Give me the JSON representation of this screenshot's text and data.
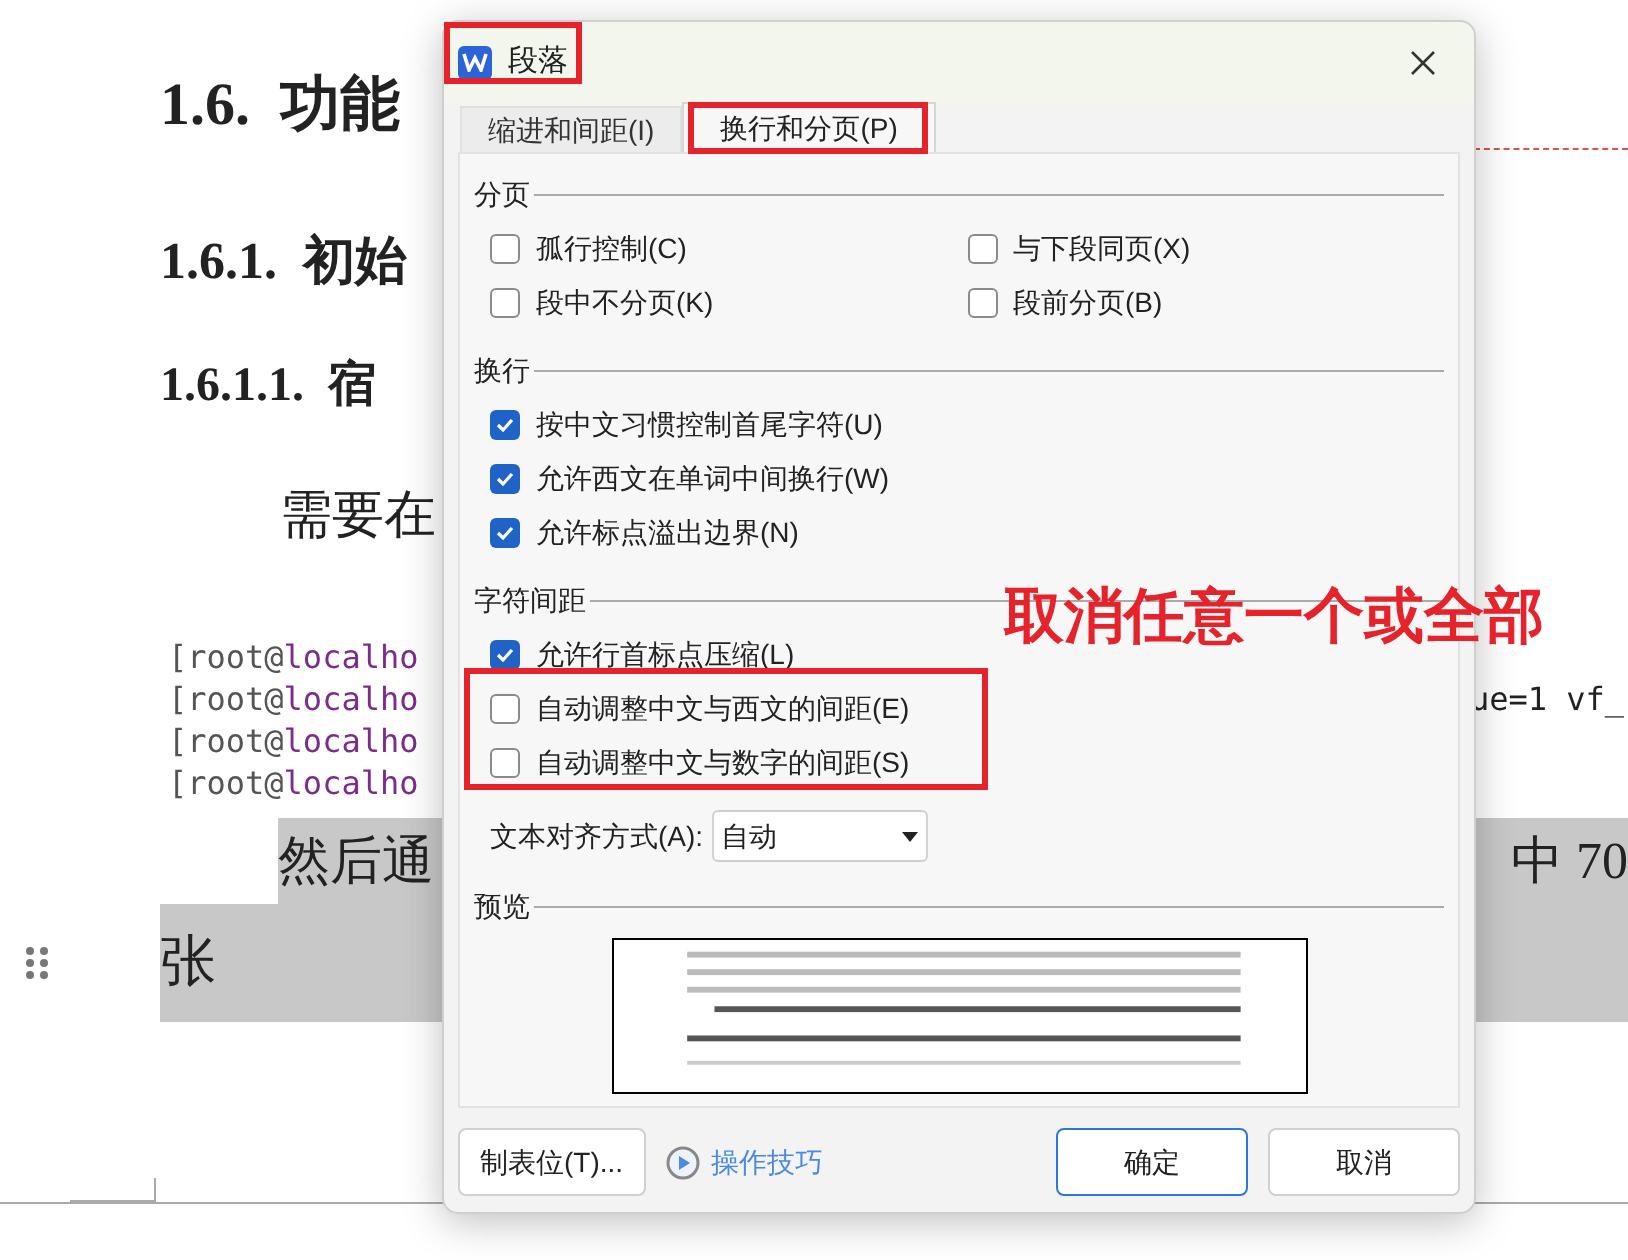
{
  "document": {
    "heading_1": "1.6.  功能",
    "heading_2": "1.6.1.  初始",
    "heading_3": "1.6.1.1.  宿",
    "paragraph": "需要在",
    "code_lines": [
      {
        "prompt": "[root@",
        "host": "localho"
      },
      {
        "prompt": "[root@",
        "host": "localho",
        "tail": "ue=1 vf_"
      },
      {
        "prompt": "[root@",
        "host": "localho"
      },
      {
        "prompt": "[root@",
        "host": "localho"
      }
    ],
    "highlight_line_1": "然后通",
    "highlight_line_1_end": "中 70",
    "highlight_line_2": "张"
  },
  "dialog": {
    "title": "段落",
    "tabs": [
      {
        "label": "缩进和间距(I)",
        "selected": false
      },
      {
        "label": "换行和分页(P)",
        "selected": true
      }
    ],
    "sections": [
      {
        "title": "分页",
        "options": [
          {
            "label": "孤行控制(C)",
            "checked": false
          },
          {
            "label": "与下段同页(X)",
            "checked": false
          },
          {
            "label": "段中不分页(K)",
            "checked": false
          },
          {
            "label": "段前分页(B)",
            "checked": false
          }
        ]
      },
      {
        "title": "换行",
        "options": [
          {
            "label": "按中文习惯控制首尾字符(U)",
            "checked": true
          },
          {
            "label": "允许西文在单词中间换行(W)",
            "checked": true
          },
          {
            "label": "允许标点溢出边界(N)",
            "checked": true
          }
        ]
      },
      {
        "title": "字符间距",
        "options": [
          {
            "label": "允许行首标点压缩(L)",
            "checked": true
          },
          {
            "label": "自动调整中文与西文的间距(E)",
            "checked": false
          },
          {
            "label": "自动调整中文与数字的间距(S)",
            "checked": false
          }
        ]
      }
    ],
    "align_label": "文本对齐方式(A):",
    "align_value": "自动",
    "preview_title": "预览",
    "tabs_button": "制表位(T)...",
    "tips_link": "操作技巧",
    "ok": "确定",
    "cancel": "取消"
  },
  "annotation": "取消任意一个或全部"
}
